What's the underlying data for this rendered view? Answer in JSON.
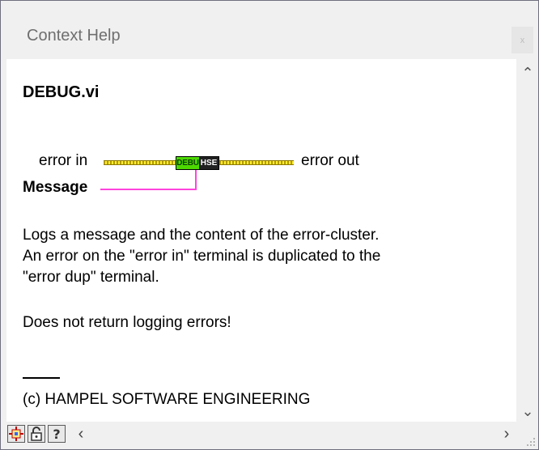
{
  "window": {
    "title": "Context Help",
    "close_label": "x"
  },
  "vi": {
    "name": "DEBUG.vi",
    "icon_left": "DEBU",
    "icon_right": "HSE"
  },
  "terminals": {
    "error_in": "error in",
    "error_out": "error out",
    "message": "Message"
  },
  "description": {
    "line1": "Logs a message and the content of the error-cluster.",
    "line2": "An error on the \"error in\" terminal is duplicated to the",
    "line3": "\"error dup\" terminal.",
    "note": "Does not return logging errors!",
    "copyright": "(c) HAMPEL SOFTWARE ENGINEERING"
  },
  "colors": {
    "error_wire": "#ffee33",
    "message_wire": "#ff44dd",
    "icon_green": "#4cd900",
    "icon_dark": "#222222"
  },
  "toolbar": {
    "buttons": [
      {
        "name": "show-optional-terminals-button",
        "icon": "terminal-icon"
      },
      {
        "name": "lock-button",
        "icon": "lock-icon"
      },
      {
        "name": "detailed-help-button",
        "icon": "help-icon"
      }
    ]
  }
}
